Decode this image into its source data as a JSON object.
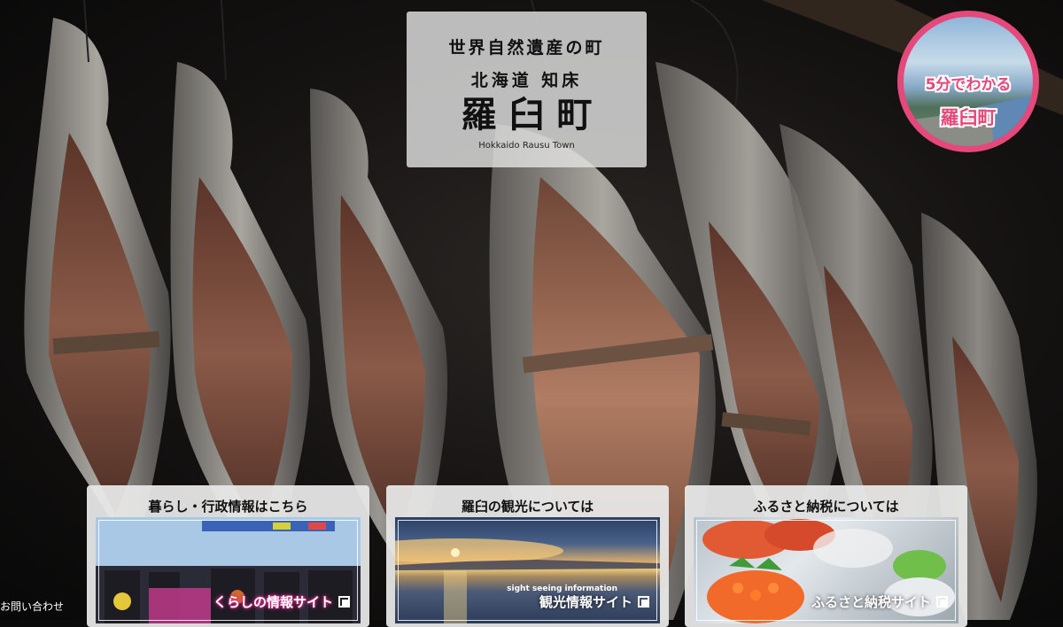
{
  "title_box": {
    "line1": "世界自然遺産の町",
    "line2": "北海道 知床",
    "line3": "羅臼町",
    "line4": "Hokkaido Rausu Town"
  },
  "badge": {
    "line1": "5分でわかる",
    "line2": "羅臼町",
    "accent": "#e5487a"
  },
  "cards": [
    {
      "caption": "暮らし・行政情報はこちら",
      "button": "くらしの情報サイト",
      "icon": "external-square-icon"
    },
    {
      "caption": "羅臼の観光については",
      "sub": "sight seeing information",
      "button": "観光情報サイト",
      "icon": "external-square-icon"
    },
    {
      "caption": "ふるさと納税については",
      "button": "ふるさと納税サイト",
      "icon": "external-square-icon"
    }
  ],
  "contact": "お問い合わせ"
}
